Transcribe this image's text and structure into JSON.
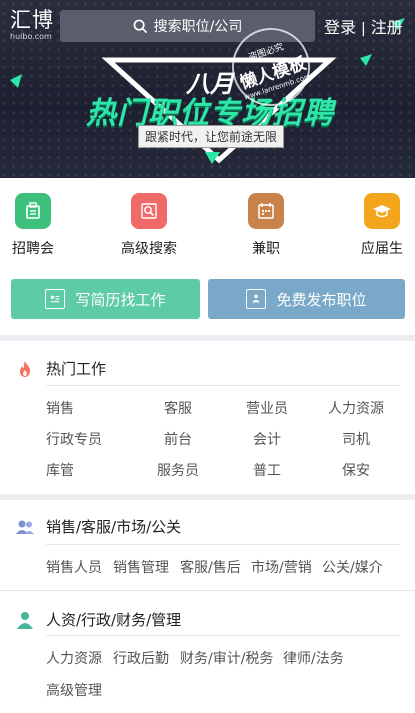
{
  "header": {
    "logo_main": "汇博",
    "logo_sub": "huibo.com",
    "search_placeholder": "搜索职位/公司",
    "login": "登录",
    "divider": "|",
    "register": "注册"
  },
  "banner": {
    "month": "八月",
    "title": "热门职位专场招聘",
    "subtitle": "跟紧时代，让您前途无限",
    "watermark_top": "盗图必究",
    "watermark_main": "懒人模板",
    "watermark_url": "www.lanrenmb.com"
  },
  "categories": [
    {
      "label": "招聘会",
      "icon": "job-fair-icon",
      "color": "#3cc07c"
    },
    {
      "label": "高级搜索",
      "icon": "advanced-search-icon",
      "color": "#f06a6a"
    },
    {
      "label": "兼职",
      "icon": "part-time-icon",
      "color": "#c9834a"
    },
    {
      "label": "应届生",
      "icon": "graduate-icon",
      "color": "#f3a51b"
    }
  ],
  "actions": {
    "resume": {
      "label": "写简历找工作",
      "color": "#5dcaa8"
    },
    "post": {
      "label": "免费发布职位",
      "color": "#7aa8c9"
    }
  },
  "hot_jobs": {
    "title": "热门工作",
    "rows": [
      [
        "销售",
        "客服",
        "营业员",
        "人力资源"
      ],
      [
        "行政专员",
        "前台",
        "会计",
        "司机"
      ],
      [
        "库管",
        "服务员",
        "普工",
        "保安"
      ]
    ]
  },
  "group_sales": {
    "title": "销售/客服/市场/公关",
    "items": [
      "销售人员",
      "销售管理",
      "客服/售后",
      "市场/营销",
      "公关/媒介"
    ]
  },
  "group_hr": {
    "title": "人资/行政/财务/管理",
    "items": [
      "人力资源",
      "行政后勤",
      "财务/审计/税务",
      "律师/法务",
      "高级管理"
    ]
  }
}
